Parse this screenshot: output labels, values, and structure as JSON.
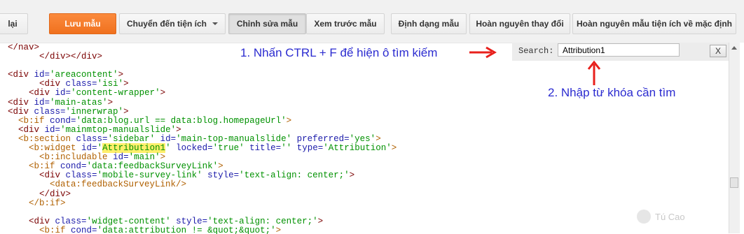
{
  "toolbar": {
    "back_label": "lại",
    "save_label": "Lưu mẫu",
    "jump_label": "Chuyển đến tiện ích",
    "edit_label": "Chỉnh sửa mẫu",
    "preview_label": "Xem trước mẫu",
    "format_label": "Định dạng mẫu",
    "revert_label": "Hoàn nguyên thay đổi",
    "revert_widgets_label": "Hoàn nguyên mẫu tiện ích về mặc định"
  },
  "search": {
    "label": "Search:",
    "value": "Attribution1",
    "close_label": "X"
  },
  "annotations": {
    "step1": "1. Nhấn CTRL + F để hiện ô tìm kiếm",
    "step2": "2. Nhập từ khóa cần tìm"
  },
  "watermark": "Tú Cao",
  "colors": {
    "accent_orange": "#f47d2b",
    "annotation_blue": "#2b2bd0",
    "arrow_red": "#e8201c",
    "highlight": "#ffef6b"
  }
}
